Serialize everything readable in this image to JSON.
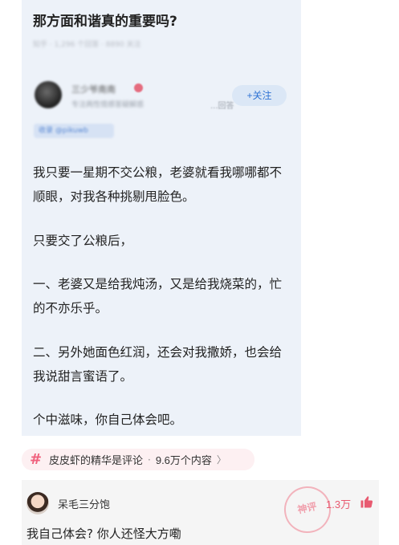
{
  "question": {
    "title": "那方面和谐真的重要吗?",
    "meta": "知乎 · 1,296 个回答 · 8890 关注"
  },
  "author": {
    "name": "三少爷南南",
    "subtitle": "专注两性情感答疑解惑",
    "level": "...回答",
    "follow_label": "+关注"
  },
  "tag": "收录 @pikuwb",
  "answer": {
    "paragraphs": [
      "我只要一星期不交公粮，老婆就看我哪哪都不顺眼，对我各种挑剔甩脸色。",
      "只要交了公粮后，",
      "一、老婆又是给我炖汤，又是给我烧菜的，忙的不亦乐乎。",
      "二、另外她面色红润，还会对我撒娇，也会给我说甜言蜜语了。",
      "个中滋味，你自己体会吧。"
    ]
  },
  "topic_strip": {
    "icon": "hash-icon",
    "text": "皮皮虾的精华是评论",
    "separator": "·",
    "count": "9.6万个内容",
    "arrow": "〉"
  },
  "comment": {
    "user": "呆毛三分饱",
    "likes": "1.3万",
    "text": "我自己体会? 你人还怪大方嘞",
    "stamp": "神评"
  },
  "colors": {
    "card_bg": "#edf2f9",
    "accent_blue": "#2f73d4",
    "accent_pink": "#f0617d",
    "like_red": "#e85a70"
  }
}
